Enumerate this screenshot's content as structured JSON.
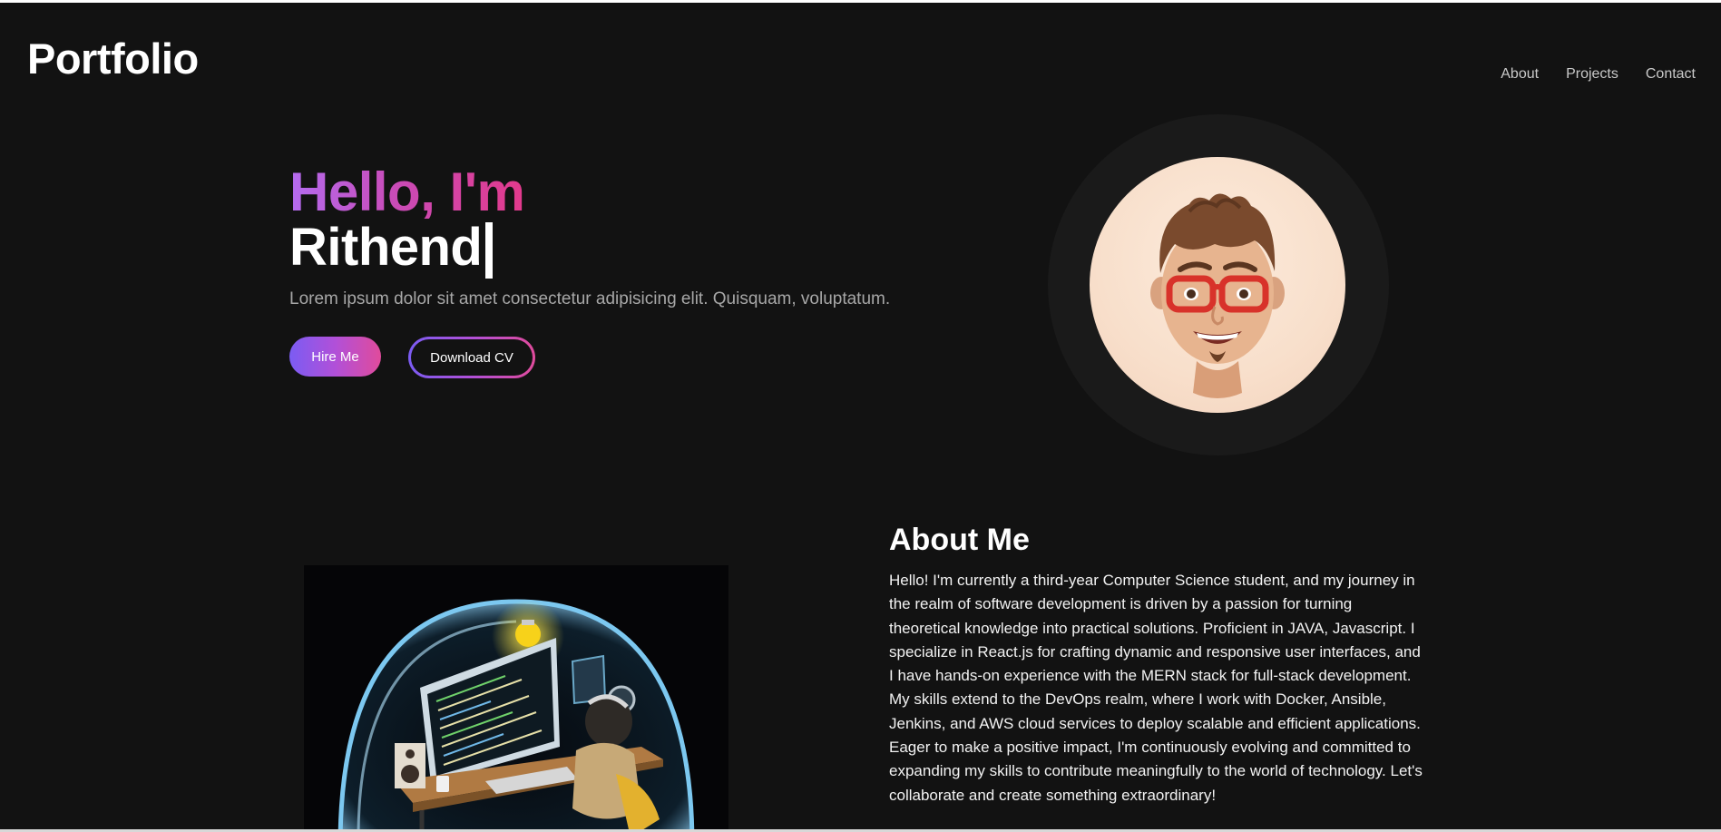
{
  "header": {
    "logo": "Portfolio",
    "nav": [
      {
        "label": "About"
      },
      {
        "label": "Projects"
      },
      {
        "label": "Contact"
      }
    ]
  },
  "hero": {
    "greeting": "Hello, I'm",
    "name": "Rithend",
    "tagline": "Lorem ipsum dolor sit amet consectetur adipisicing elit. Quisquam, voluptatum.",
    "hire_label": "Hire Me",
    "download_label": "Download CV",
    "avatar_icon": "memoji-avatar"
  },
  "about": {
    "title": "About Me",
    "image_icon": "developer-workspace-illustration",
    "text": "Hello! I'm currently a third-year Computer Science student, and my journey in the realm of software development is driven by a passion for turning theoretical knowledge into practical solutions. Proficient in JAVA, Javascript. I specialize in React.js for crafting dynamic and responsive user interfaces, and I have hands-on experience with the MERN stack for full-stack development. My skills extend to the DevOps realm, where I work with Docker, Ansible, Jenkins, and AWS cloud services to deploy scalable and efficient applications. Eager to make a positive impact, I'm continuously evolving and committed to expanding my skills to contribute meaningfully to the world of technology. Let's collaborate and create something extraordinary!"
  },
  "colors": {
    "background": "#121212",
    "gradient_start": "#7b5cf3",
    "gradient_mid": "#b150d8",
    "gradient_end": "#e04b9c",
    "muted_text": "#a7a7a7"
  }
}
